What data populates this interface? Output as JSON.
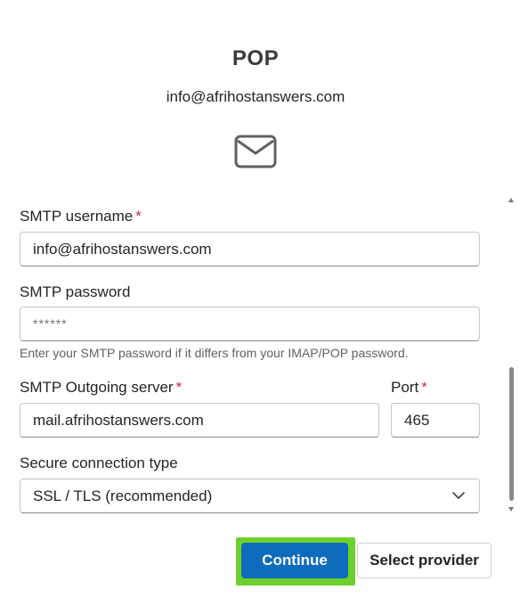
{
  "header": {
    "title": "POP",
    "account_email": "info@afrihostanswers.com",
    "icon": "mail-icon"
  },
  "form": {
    "smtp_username": {
      "label": "SMTP username",
      "required_mark": "*",
      "value": "info@afrihostanswers.com"
    },
    "smtp_password": {
      "label": "SMTP password",
      "value": "******",
      "hint": "Enter your SMTP password if it differs from your IMAP/POP password."
    },
    "smtp_server": {
      "label": "SMTP Outgoing server",
      "required_mark": "*",
      "value": "mail.afrihostanswers.com"
    },
    "port": {
      "label": "Port",
      "required_mark": "*",
      "value": "465"
    },
    "secure_connection": {
      "label": "Secure connection type",
      "selected": "SSL / TLS (recommended)",
      "icon": "chevron-down-icon"
    }
  },
  "actions": {
    "continue_label": "Continue",
    "select_provider_label": "Select provider",
    "highlight_color": "#6ed02a",
    "primary_color": "#0f6cbd"
  }
}
